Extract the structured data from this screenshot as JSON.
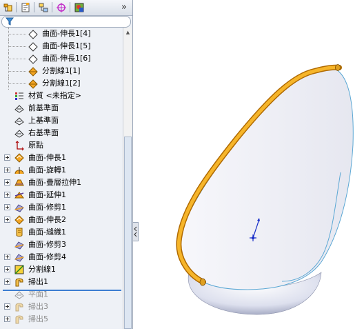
{
  "toolbar": {
    "buttons": [
      "feature-manager-icon",
      "property-manager-icon",
      "configuration-manager-icon",
      "dimxpert-icon",
      "display-manager-icon"
    ],
    "more": "»"
  },
  "tree": {
    "items": [
      {
        "label": "曲面-伸長1[4]",
        "icon": "extrude-surface-outline-icon",
        "indent": 2,
        "expand": false,
        "grey": false
      },
      {
        "label": "曲面-伸長1[5]",
        "icon": "extrude-surface-outline-icon",
        "indent": 2,
        "expand": false,
        "grey": false
      },
      {
        "label": "曲面-伸長1[6]",
        "icon": "extrude-surface-outline-icon",
        "indent": 2,
        "expand": false,
        "grey": false
      },
      {
        "label": "分割線1[1]",
        "icon": "split-line-icon",
        "indent": 2,
        "expand": false,
        "grey": false
      },
      {
        "label": "分割線1[2]",
        "icon": "split-line-icon",
        "indent": 2,
        "expand": false,
        "grey": false
      },
      {
        "label": "材質 <未指定>",
        "icon": "material-icon",
        "indent": 1,
        "expand": false,
        "grey": false
      },
      {
        "label": "前基準面",
        "icon": "plane-icon",
        "indent": 1,
        "expand": false,
        "grey": false
      },
      {
        "label": "上基準面",
        "icon": "plane-icon",
        "indent": 1,
        "expand": false,
        "grey": false
      },
      {
        "label": "右基準面",
        "icon": "plane-icon",
        "indent": 1,
        "expand": false,
        "grey": false
      },
      {
        "label": "原點",
        "icon": "origin-icon",
        "indent": 1,
        "expand": false,
        "grey": false
      },
      {
        "label": "曲面-伸長1",
        "icon": "extrude-surface-icon",
        "indent": 1,
        "expand": true,
        "grey": false
      },
      {
        "label": "曲面-旋轉1",
        "icon": "revolve-surface-icon",
        "indent": 1,
        "expand": true,
        "grey": false
      },
      {
        "label": "曲面-疊層拉伸1",
        "icon": "loft-surface-icon",
        "indent": 1,
        "expand": true,
        "grey": false
      },
      {
        "label": "曲面-延伸1",
        "icon": "extend-surface-icon",
        "indent": 1,
        "expand": true,
        "grey": false
      },
      {
        "label": "曲面-修剪1",
        "icon": "trim-surface-icon",
        "indent": 1,
        "expand": true,
        "grey": false
      },
      {
        "label": "曲面-伸長2",
        "icon": "extrude-surface-icon",
        "indent": 1,
        "expand": true,
        "grey": false
      },
      {
        "label": "曲面-縫織1",
        "icon": "knit-surface-icon",
        "indent": 1,
        "expand": false,
        "grey": false
      },
      {
        "label": "曲面-修剪3",
        "icon": "trim-surface-icon",
        "indent": 1,
        "expand": false,
        "grey": false
      },
      {
        "label": "曲面-修剪4",
        "icon": "trim-surface-icon",
        "indent": 1,
        "expand": true,
        "grey": false
      },
      {
        "label": "分割線1",
        "icon": "split-line-feature-icon",
        "indent": 1,
        "expand": true,
        "grey": false
      },
      {
        "label": "掃出1",
        "icon": "sweep-icon",
        "indent": 1,
        "expand": true,
        "grey": false
      },
      {
        "label": "平面1",
        "icon": "plane-icon",
        "indent": 1,
        "expand": false,
        "grey": true
      },
      {
        "label": "掃出3",
        "icon": "sweep-icon",
        "indent": 1,
        "expand": true,
        "grey": true
      },
      {
        "label": "掃出5",
        "icon": "sweep-icon",
        "indent": 1,
        "expand": true,
        "grey": true
      }
    ]
  },
  "colors": {
    "panel": "#eef1f6",
    "rollback": "#3c7dd1",
    "sweep": "#f0a818",
    "surface_edge": "#4a9ac8",
    "triad": "#1a2fc8"
  }
}
